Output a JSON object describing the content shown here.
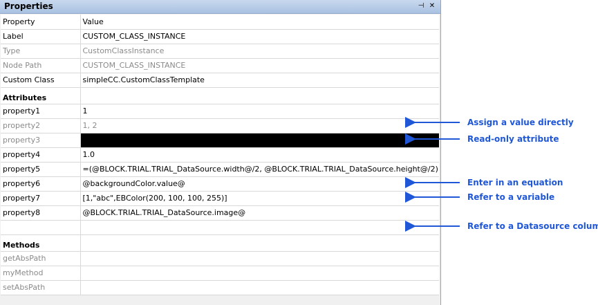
{
  "panel": {
    "title": "Properties",
    "pin_glyph": "⊣",
    "close_glyph": "✕"
  },
  "columns": {
    "property": "Property",
    "value": "Value"
  },
  "general": [
    {
      "name": "Label",
      "value": "CUSTOM_CLASS_INSTANCE",
      "readonly": false
    },
    {
      "name": "Type",
      "value": "CustomClassInstance",
      "readonly": true
    },
    {
      "name": "Node Path",
      "value": "CUSTOM_CLASS_INSTANCE",
      "readonly": true
    },
    {
      "name": "Custom Class",
      "value": "simpleCC.CustomClassTemplate",
      "readonly": false
    }
  ],
  "attributes_header": "Attributes",
  "attributes": [
    {
      "name": "property1",
      "value": "1"
    },
    {
      "name": "property2",
      "value": "1, 2"
    },
    {
      "name": "property3",
      "value": ""
    },
    {
      "name": "property4",
      "value": "1.0"
    },
    {
      "name": "property5",
      "value": "=(@BLOCK.TRIAL.TRIAL_DataSource.width@/2, @BLOCK.TRIAL.TRIAL_DataSource.height@/2)"
    },
    {
      "name": "property6",
      "value": "@backgroundColor.value@"
    },
    {
      "name": "property7",
      "value": "[1,\"abc\",EBColor(200, 100, 100, 255)]"
    },
    {
      "name": "property8",
      "value": "@BLOCK.TRIAL.TRIAL_DataSource.image@"
    }
  ],
  "methods_header": "Methods",
  "methods": [
    {
      "name": "getAbsPath"
    },
    {
      "name": "myMethod"
    },
    {
      "name": "setAbsPath"
    }
  ],
  "annotations": {
    "color": "#1f57d6",
    "items": [
      {
        "text": "Assign a value directly"
      },
      {
        "text": "Read-only attribute"
      },
      {
        "text": "Enter in an equation"
      },
      {
        "text": "Refer to a variable"
      },
      {
        "text": "Refer to a Datasource column"
      }
    ]
  }
}
